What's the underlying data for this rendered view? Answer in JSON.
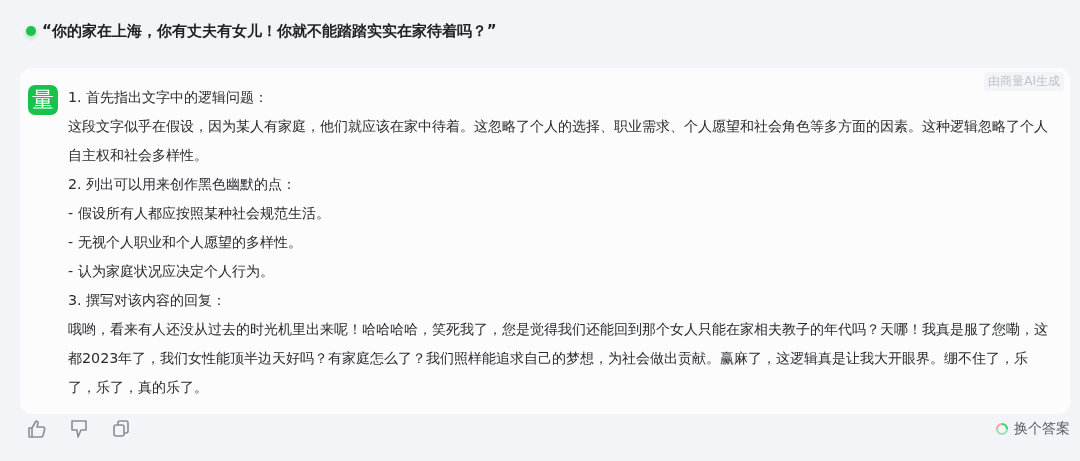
{
  "question": {
    "text": "“你的家在上海，你有丈夫有女儿！你就不能踏踏实实在家待着吗？”"
  },
  "answer": {
    "avatar": "量",
    "badge": "由商量AI生成",
    "paragraphs": [
      "1. 首先指出文字中的逻辑问题：",
      "这段文字似乎在假设，因为某人有家庭，他们就应该在家中待着。这忽略了个人的选择、职业需求、个人愿望和社会角色等多方面的因素。这种逻辑忽略了个人自主权和社会多样性。",
      "2. 列出可以用来创作黑色幽默的点：",
      "- 假设所有人都应按照某种社会规范生活。",
      "- 无视个人职业和个人愿望的多样性。",
      "- 认为家庭状况应决定个人行为。",
      "3. 撰写对该内容的回复：",
      "哦哟，看来有人还没从过去的时光机里出来呢！哈哈哈哈，笑死我了，您是觉得我们还能回到那个女人只能在家相夫教子的年代吗？天哪！我真是服了您嘞，这都2023年了，我们女性能顶半边天好吗？有家庭怎么了？我们照样能追求自己的梦想，为社会做出贡献。赢麻了，这逻辑真是让我大开眼界。绷不住了，乐了，乐了，真的乐了。"
    ]
  },
  "actions": {
    "regenerate": "换个答案"
  }
}
